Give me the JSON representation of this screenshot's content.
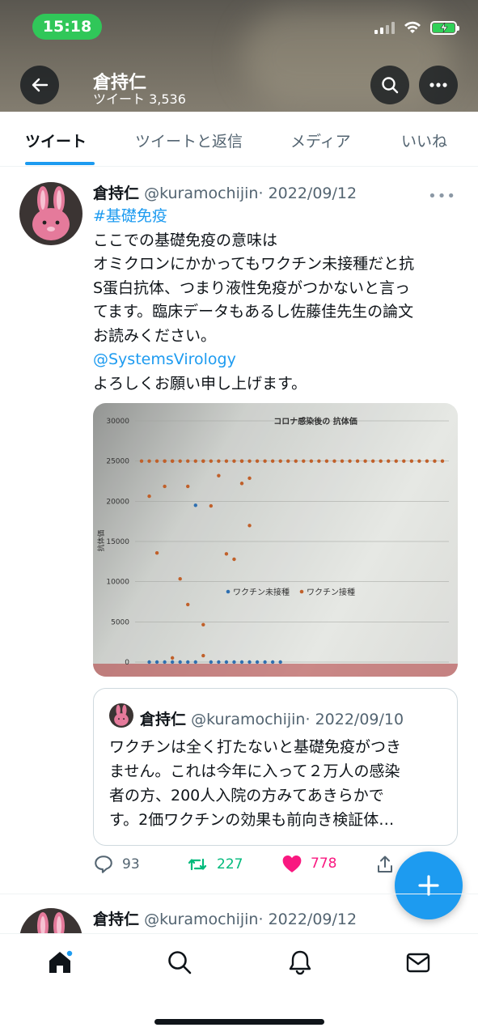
{
  "status_bar": {
    "time": "15:18"
  },
  "header": {
    "name": "倉持仁",
    "tweet_count": "ツイート 3,536"
  },
  "tabs": [
    "ツイート",
    "ツイートと返信",
    "メディア",
    "いいね"
  ],
  "tweet": {
    "name": "倉持仁",
    "handle": "@kuramochijin",
    "date": "· 2022/09/12",
    "hashtag": "#基礎免疫",
    "lines": [
      "ここでの基礎免疫の意味は",
      "オミクロンにかかってもワクチン未接種だと抗",
      "S蛋白抗体、つまり液性免疫がつかないと言っ",
      "てます。臨床データもあるし佐藤佳先生の論文",
      "お読みください。"
    ],
    "mention": "@SystemsVirology",
    "closing": "よろしくお願い申し上げます。",
    "quote": {
      "name": "倉持仁",
      "handle": "@kuramochijin",
      "date": "· 2022/09/10",
      "lines": [
        "ワクチンは全く打たないと基礎免疫がつき",
        "ません。これは今年に入って２万人の感染",
        "者の方、200人入院の方みてあきらかで",
        "す。2価ワクチンの効果も前向き検証体…"
      ]
    },
    "replies": "93",
    "retweets": "227",
    "likes": "778"
  },
  "next_tweet": {
    "name": "倉持仁",
    "handle": "@kuramochijin",
    "date": "· 2022/09/12"
  },
  "chart_data": {
    "type": "scatter",
    "title": "コロナ感染後の 抗体価",
    "ylabel": "抗体価",
    "ylim": [
      0,
      30000
    ],
    "yticks": [
      0,
      5000,
      10000,
      15000,
      20000,
      25000,
      30000
    ],
    "legend_position": "center-right",
    "series": [
      {
        "name": "ワクチン未接種",
        "color": "#2e6fb0",
        "points": [
          [
            1,
            0
          ],
          [
            2,
            0
          ],
          [
            3,
            0
          ],
          [
            4,
            0
          ],
          [
            5,
            0
          ],
          [
            6,
            0
          ],
          [
            7,
            0
          ],
          [
            9,
            0
          ],
          [
            10,
            0
          ],
          [
            11,
            0
          ],
          [
            12,
            0
          ],
          [
            13,
            0
          ],
          [
            14,
            0
          ],
          [
            15,
            0
          ],
          [
            16,
            0
          ],
          [
            17,
            0
          ],
          [
            18,
            0
          ],
          [
            7,
            19500
          ]
        ]
      },
      {
        "name": "ワクチン接種",
        "color": "#c0602a",
        "points": [
          [
            1,
            20627
          ],
          [
            2,
            13570
          ],
          [
            3,
            25000
          ],
          [
            3,
            21847
          ],
          [
            4,
            25000
          ],
          [
            5,
            10347
          ],
          [
            6,
            7154
          ],
          [
            6,
            21847
          ],
          [
            8,
            4653
          ],
          [
            8,
            25000
          ],
          [
            9,
            19427
          ],
          [
            10,
            23186
          ],
          [
            11,
            13460
          ],
          [
            12,
            12786
          ],
          [
            13,
            22222
          ],
          [
            14,
            16985
          ],
          [
            14,
            22871
          ],
          [
            4,
            516
          ],
          [
            8,
            800
          ],
          [
            13,
            25000
          ]
        ]
      },
      {
        "name": "",
        "color": "#c0602a",
        "points": [
          [
            0,
            25000
          ],
          [
            1,
            25000
          ],
          [
            2,
            25000
          ],
          [
            3,
            25000
          ],
          [
            4,
            25000
          ],
          [
            5,
            25000
          ],
          [
            6,
            25000
          ],
          [
            7,
            25000
          ],
          [
            8,
            25000
          ],
          [
            9,
            25000
          ],
          [
            10,
            25000
          ],
          [
            11,
            25000
          ],
          [
            12,
            25000
          ],
          [
            13,
            25000
          ],
          [
            14,
            25000
          ],
          [
            15,
            25000
          ],
          [
            16,
            25000
          ],
          [
            17,
            25000
          ],
          [
            18,
            25000
          ],
          [
            19,
            25000
          ],
          [
            20,
            25000
          ],
          [
            21,
            25000
          ],
          [
            22,
            25000
          ],
          [
            23,
            25000
          ],
          [
            24,
            25000
          ],
          [
            25,
            25000
          ],
          [
            26,
            25000
          ],
          [
            27,
            25000
          ],
          [
            28,
            25000
          ],
          [
            29,
            25000
          ],
          [
            30,
            25000
          ],
          [
            31,
            25000
          ],
          [
            32,
            25000
          ],
          [
            33,
            25000
          ],
          [
            34,
            25000
          ],
          [
            35,
            25000
          ],
          [
            36,
            25000
          ],
          [
            37,
            25000
          ],
          [
            38,
            25000
          ],
          [
            39,
            25000
          ]
        ]
      }
    ]
  },
  "colors": {
    "accent": "#1d9bf0",
    "like": "#f91880",
    "retweet": "#00ba7c",
    "status_pill": "#30c759"
  }
}
